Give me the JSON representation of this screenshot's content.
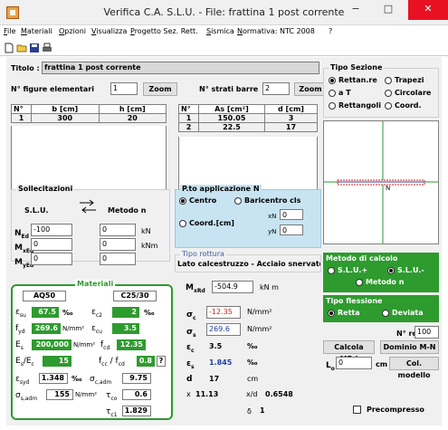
{
  "window": {
    "title": "Verifica C.A. S.L.U. - File: frattina 1 post corrente",
    "minimize": "−",
    "maximize": "□",
    "close": "✕"
  },
  "menu": [
    "File",
    "Materiali",
    "Opzioni",
    "Visualizza",
    "Progetto Sez. Rett.",
    "Sismica",
    "Normativa: NTC 2008",
    "?"
  ],
  "toolbar": [
    "new-file-icon",
    "open-folder-icon",
    "save-icon",
    "print-icon"
  ],
  "titolo": {
    "label": "Titolo :",
    "value": "frattina 1 post corrente"
  },
  "figure": {
    "label": "N° figure elementari",
    "value": "1",
    "zoom": "Zoom"
  },
  "strati": {
    "label": "N° strati barre",
    "value": "2",
    "zoom": "Zoom"
  },
  "figure_table": {
    "headers": [
      "N°",
      "b [cm]",
      "h [cm]"
    ],
    "rows": [
      [
        "1",
        "300",
        "20"
      ]
    ]
  },
  "barre_table": {
    "headers": [
      "N°",
      "As [cm²]",
      "d [cm]"
    ],
    "rows": [
      [
        "1",
        "150.05",
        "3"
      ],
      [
        "2",
        "22.5",
        "17"
      ]
    ]
  },
  "tipo_sezione": {
    "title": "Tipo Sezione",
    "options": [
      {
        "label": "Rettan.re",
        "selected": true
      },
      {
        "label": "Trapezi",
        "selected": false
      },
      {
        "label": "a T",
        "selected": false
      },
      {
        "label": "Circolare",
        "selected": false
      },
      {
        "label": "Rettangoli",
        "selected": false
      },
      {
        "label": "Coord.",
        "selected": false
      }
    ]
  },
  "section_drawing": {
    "axis_label": "N"
  },
  "sollecitazioni": {
    "title": "Sollecitazioni",
    "slu": "S.L.U.",
    "metodo": "Metodo n",
    "ned": {
      "sym": "N",
      "sub": "Ed",
      "value": "-100"
    },
    "mxed": {
      "sym": "M",
      "sub": "xEd",
      "value": "0",
      "unit": "kNm"
    },
    "myed": {
      "sym": "M",
      "sub": "yEd",
      "value": "0"
    },
    "col2_top": "0",
    "col2_mid": "0",
    "col2_bot": "0",
    "unit_kn": "kN"
  },
  "applicazione": {
    "title": "P.to applicazione N",
    "centro": "Centro",
    "baricentro": "Baricentro cls",
    "coord": "Coord.[cm]",
    "xn_label": "xN",
    "xn": "0",
    "yn_label": "yN",
    "yn": "0"
  },
  "rottura": {
    "title": "Tipo rottura",
    "value": "Lato calcestruzzo - Acciaio snervato"
  },
  "mxrd": {
    "sym": "M",
    "sub": "xRd",
    "value": "-504.9",
    "unit": "kN m"
  },
  "metodo_calcolo": {
    "title": "Metodo di calcolo",
    "options": [
      {
        "label": "S.L.U.+",
        "selected": false
      },
      {
        "label": "S.L.U.-",
        "selected": true
      },
      {
        "label": "Metodo n",
        "selected": false
      }
    ]
  },
  "tipo_flessione": {
    "title": "Tipo flessione",
    "options": [
      {
        "label": "Retta",
        "selected": true
      },
      {
        "label": "Deviata",
        "selected": false
      }
    ]
  },
  "nrett": {
    "label": "N° rett.",
    "value": "100"
  },
  "buttons": {
    "calcola": "Calcola MRd",
    "dominio": "Dominio M-N",
    "col_modello": "Col. modello"
  },
  "lo": {
    "label": "L",
    "sub": "o",
    "value": "0",
    "unit": "cm"
  },
  "precompresso": {
    "label": "Precompresso",
    "checked": false
  },
  "materiali": {
    "title": "Materiali",
    "steel": "AQ50",
    "concrete": "C25/30",
    "esu": "67.5",
    "esu_unit": "‰",
    "ec2": "2",
    "ec2_unit": "‰",
    "fyd": "269.6",
    "fyd_unit": "N/mm²",
    "ecu": "3.5",
    "es": "200,000",
    "es_unit": "N/mm²",
    "fcd": "12.35",
    "ratio": "15",
    "fcc": "0.8",
    "fcc_btn": "?",
    "esyd": "1.348",
    "esyd_unit": "‰",
    "sc_adm": "9.75",
    "ss_adm": "155",
    "ss_adm_unit": "N/mm²",
    "tc0": "0.6",
    "tc1": "1.829"
  },
  "results": {
    "sigma_c": "-12.35",
    "sigma_c_unit": "N/mm²",
    "sigma_s": "269.6",
    "sigma_s_unit": "N/mm²",
    "eps_c": "3.5",
    "eps_c_unit": "‰",
    "eps_s": "1.845",
    "eps_s_unit": "‰",
    "d": "17",
    "d_unit": "cm",
    "x_label": "x",
    "x": "11.13",
    "xd_label": "x/d",
    "xd": "0.6548",
    "delta_label": "δ",
    "delta": "1"
  }
}
